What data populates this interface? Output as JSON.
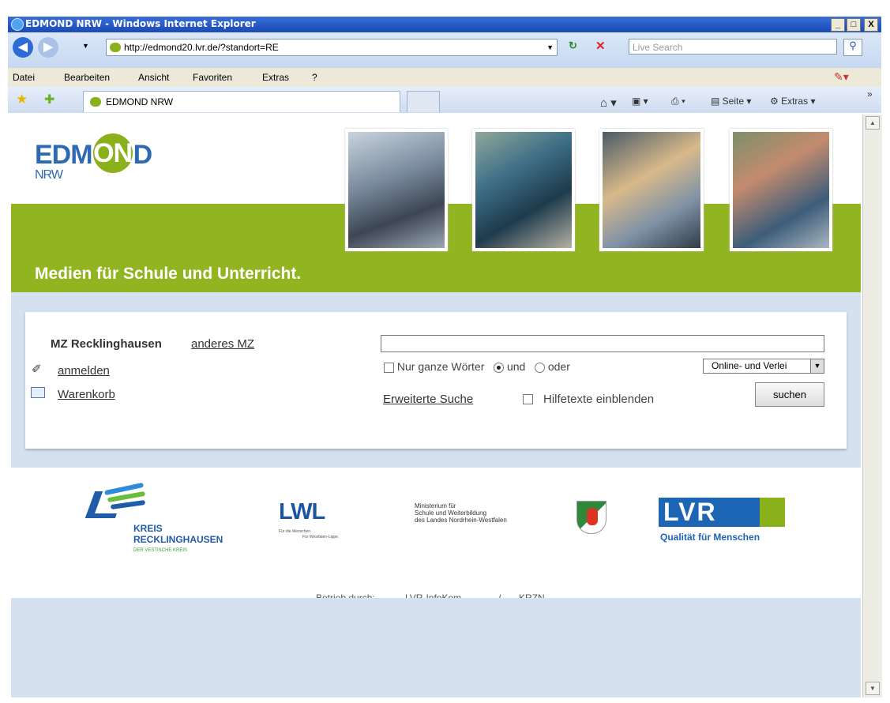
{
  "window": {
    "title": "EDMOND NRW - Windows Internet Explorer",
    "url": "http://edmond20.lvr.de/?standort=RE",
    "search_placeholder": "Live Search",
    "buttons": {
      "minimize": "_",
      "maximize": "□",
      "close": "X"
    }
  },
  "menu": [
    "Datei",
    "Bearbeiten",
    "Ansicht",
    "Favoriten",
    "Extras",
    "?"
  ],
  "tab": {
    "label": "EDMOND NRW"
  },
  "commandbar": {
    "page": "Seite",
    "tools": "Extras"
  },
  "site": {
    "logo_main": [
      "EDM",
      "ON",
      "D"
    ],
    "logo_sub": "NRW",
    "slogan": "Medien für Schule und Unterricht.",
    "location": "MZ Recklinghausen",
    "change_location": "anderes MZ",
    "login": "anmelden",
    "cart": "Warenkorb",
    "search": {
      "whole_words": "Nur ganze Wörter",
      "and": "und",
      "or": "oder",
      "scope": "Online- und Verlei",
      "advanced": "Erweiterte Suche",
      "help": "Hilfetexte einblenden",
      "submit": "suchen"
    },
    "partners": {
      "kreis": [
        "KREIS",
        "RECKLINGHAUSEN",
        "DER VESTISCHE KREIS"
      ],
      "lwl": "LWL",
      "lwl_sub1": "Für die Menschen.",
      "lwl_sub2": "Für Westfalen-Lippe.",
      "ministry": [
        "Ministerium für",
        "Schule und Weiterbildung",
        "des Landes Nordrhein-Westfalen"
      ],
      "lvr": "LVR",
      "lvr_sub": "Qualität für Menschen"
    },
    "operated_by_label": "Betrieb durch:",
    "operators": [
      "LVR-InfoKom",
      "/",
      "KRZN"
    ]
  },
  "colors": {
    "green": "#91b520",
    "blue": "#d5e1ee",
    "edmond_blue": "#2e69b3"
  }
}
